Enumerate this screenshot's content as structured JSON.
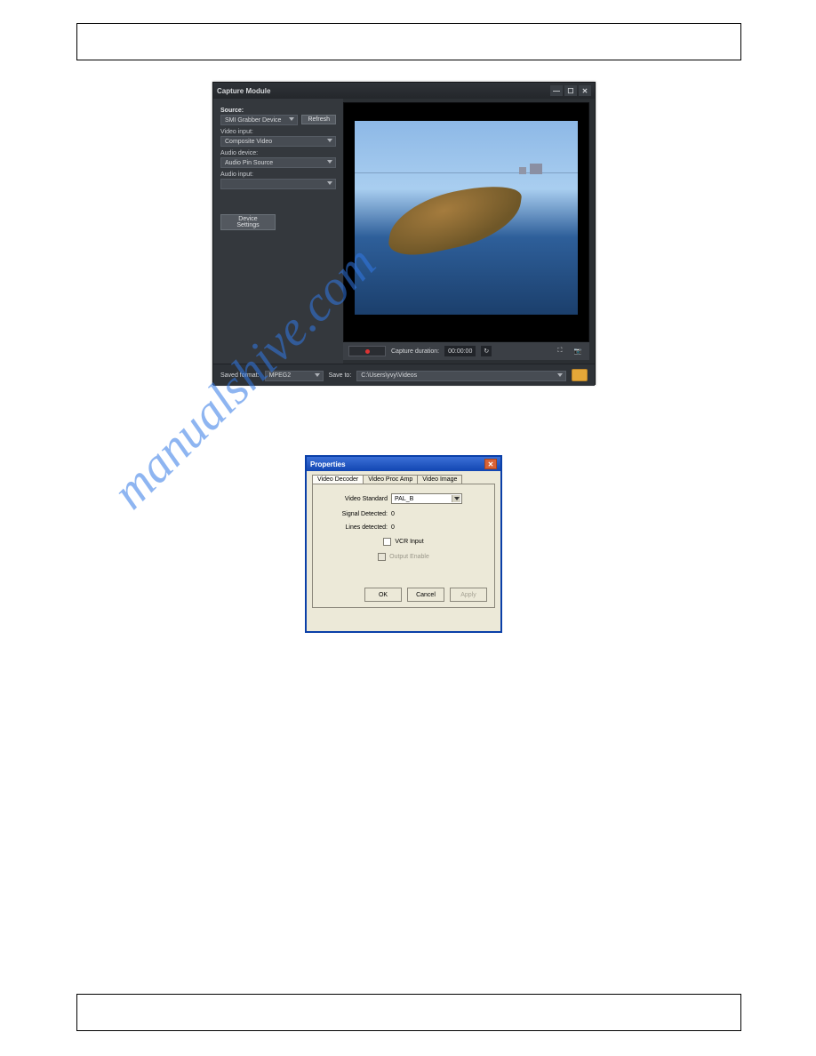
{
  "watermark": "manualshive.com",
  "capture": {
    "title": "Capture Module",
    "source_label": "Source:",
    "source_value": "SMI Grabber Device",
    "refresh": "Refresh",
    "video_input_label": "Video input:",
    "video_input_value": "Composite Video",
    "audio_device_label": "Audio device:",
    "audio_device_value": "Audio Pin Source",
    "audio_input_label": "Audio input:",
    "audio_input_value": "",
    "device_settings": "Device Settings",
    "capture_duration_label": "Capture duration:",
    "capture_duration_value": "00:00:00",
    "saved_format_label": "Saved format:",
    "saved_format_value": "MPEG2",
    "save_to_label": "Save to:",
    "save_to_value": "C:\\Users\\yvy\\Videos"
  },
  "properties": {
    "title": "Properties",
    "tabs": {
      "decoder": "Video Decoder",
      "procamp": "Video Proc Amp",
      "image": "Video Image"
    },
    "video_standard_label": "Video Standard",
    "video_standard_value": "PAL_B",
    "signal_detected_label": "Signal Detected:",
    "signal_detected_value": "0",
    "lines_detected_label": "Lines detected:",
    "lines_detected_value": "0",
    "vcr_input": "VCR Input",
    "output_enable": "Output Enable",
    "ok": "OK",
    "cancel": "Cancel",
    "apply": "Apply"
  }
}
